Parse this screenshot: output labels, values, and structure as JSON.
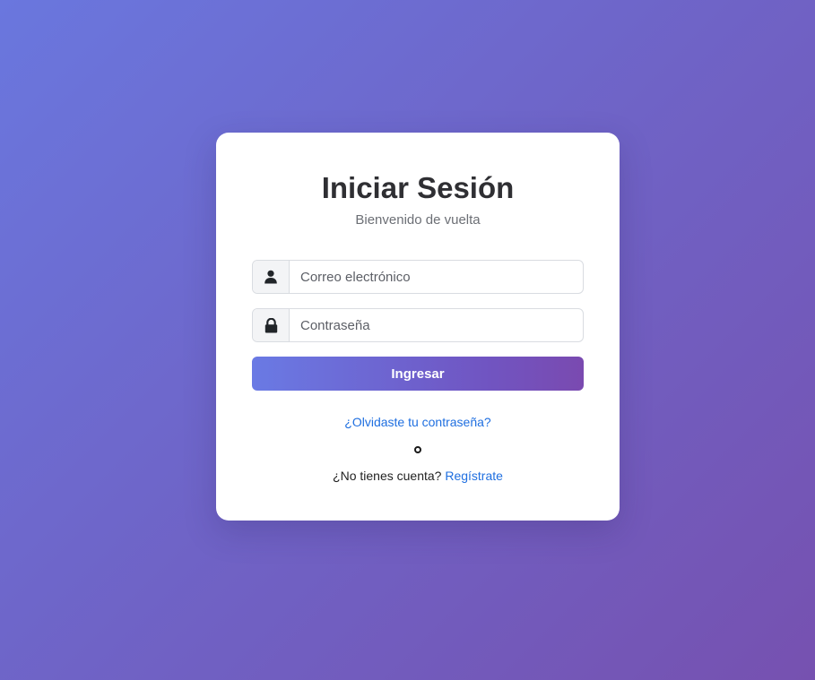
{
  "login": {
    "title": "Iniciar Sesión",
    "subtitle": "Bienvenido de vuelta",
    "email": {
      "placeholder": "Correo electrónico",
      "value": "",
      "icon": "user-icon"
    },
    "password": {
      "placeholder": "Contraseña",
      "value": "",
      "icon": "lock-icon"
    },
    "submit_label": "Ingresar",
    "forgot_link": "¿Olvidaste tu contraseña?",
    "signup_prompt": "¿No tienes cuenta?",
    "signup_link": "Regístrate"
  },
  "colors": {
    "background_start": "#6a77de",
    "background_end": "#7651b0",
    "button_start": "#6a7ae4",
    "button_end": "#7a4ab0",
    "link": "#1f6fe0",
    "title": "#2f2f33"
  }
}
